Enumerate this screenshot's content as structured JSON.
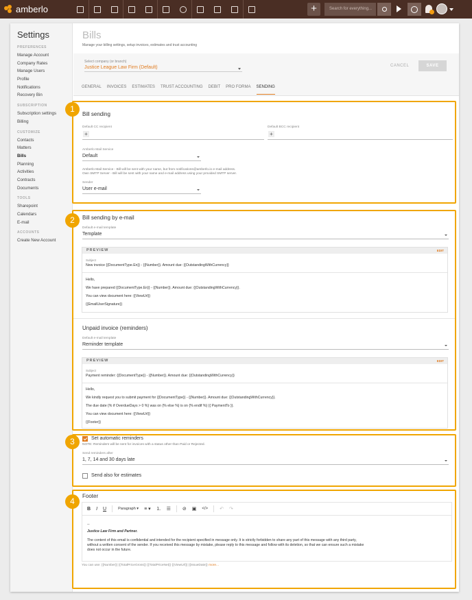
{
  "topbar": {
    "brand": "amberlo",
    "search_placeholder": "Search for everything...",
    "plus": "+",
    "nav_icons": [
      "dashboard-icon",
      "contacts-icon",
      "matters-icon",
      "documents-icon",
      "billing-icon",
      "calendar-icon",
      "time-icon",
      "folder-icon",
      "templates-icon",
      "mail-icon",
      "reports-icon"
    ]
  },
  "sidebar": {
    "title": "Settings",
    "sections": [
      {
        "header": "PREFERENCES",
        "items": [
          "Manage Account",
          "Company Rates",
          "Manage Users",
          "Profile",
          "Notifications",
          "Recovery Bin"
        ]
      },
      {
        "header": "SUBSCRIPTION",
        "items": [
          "Subscription settings",
          "Billing"
        ]
      },
      {
        "header": "CUSTOMIZE",
        "items": [
          "Contacts",
          "Matters",
          "Bills",
          "Planning",
          "Activities",
          "Contracts",
          "Documents"
        ]
      },
      {
        "header": "TOOLS",
        "items": [
          "Sharepoint",
          "Calendars",
          "E-mail"
        ]
      },
      {
        "header": "ACCOUNTS",
        "items": [
          "Create New Account"
        ]
      }
    ],
    "active": "Bills"
  },
  "page": {
    "title": "Bills",
    "subtitle": "Manage your billing settings, setup invoices, estimates and trust accounting",
    "company_label": "Select company (or branch)",
    "company_value": "Justice League Law Firm (Default)",
    "cancel": "CANCEL",
    "save": "SAVE",
    "tabs": [
      "GENERAL",
      "INVOICES",
      "ESTIMATES",
      "TRUST ACCOUNTING",
      "DEBIT",
      "PRO FORMA",
      "SENDING"
    ],
    "active_tab": "SENDING"
  },
  "sections": {
    "s1": {
      "badge": "1",
      "title": "Bill sending",
      "cc_label": "Default CC recipient",
      "bcc_label": "Default BCC recipient",
      "add": "+",
      "service_label": "Amberlo Mail Service",
      "service_value": "Default",
      "note1": "Amberlo Mail Service - Bill will be sent with your name, but from notifications@amberlo.io e-mail address.",
      "note2": "Own SMTP Server - Bill will be sent with your name and e-mail address using your provided SMTP server.",
      "sender_label": "Sender",
      "sender_value": "User e-mail"
    },
    "s2": {
      "badge": "2",
      "title": "Bill sending by e-mail",
      "tpl_label": "Default e-mail template",
      "tpl_value": "Template",
      "preview": "PREVIEW",
      "edit": "EDIT",
      "subject_label": "Subject",
      "subject": "New invoice {{DocumentType.En}} - {{Number}}. Amount due: {{OutstandingWithCurrency}}",
      "body": [
        "Hello,",
        "We have prepared {{DocumentType.En}} - {{Number}}. Amount due: {{OutstandingWithCurrency}}.",
        "You can view document here: {{ViewUrl}}",
        "{{EmailUserSignature}}"
      ],
      "unpaid_title": "Unpaid invoice (reminders)",
      "tpl2_label": "Default e-mail template",
      "tpl2_value": "Reminder template",
      "subject2": "Payment reminder: {{DocumentType}} - {{Number}}. Amount due: {{OutstandingWithCurrency}}",
      "body2": [
        "Hello,",
        "We kindly request you to submit payment for {{DocumentType}} - {{Number}}. Amount due: {{OutstandingWithCurrency}}.",
        "The due date {% if OverdueDays > 0 %} was on {% else %} is on {% endif %} {{ PaymentTo }}.",
        "You can view document here: {{ViewUrl}}",
        "{{Footer}}"
      ]
    },
    "s3": {
      "badge": "3",
      "auto_label": "Set automatic reminders",
      "auto_checked": true,
      "note": "NOTE: Reminders will be sent for invoices with a status other than Paid or Rejected.",
      "after_label": "Send reminders after",
      "after_value": "1, 7, 14 and 30 days late",
      "estimates_label": "Send also for estimates",
      "estimates_checked": false
    },
    "s4": {
      "badge": "4",
      "title": "Footer",
      "toolbar": {
        "bold": "B",
        "italic": "I",
        "underline": "U",
        "paragraph": "Paragraph ▾",
        "align": "≡ ▾",
        "ol": "⒈",
        "ul": "☰",
        "link": "⊘",
        "image": "▣",
        "code": "</>",
        "undo": "↶",
        "redo": "↷"
      },
      "lines": [
        "--",
        "Justice Law Firm and Partner.",
        "The content of this email is confidential and intended for the recipient specified in message only. It is strictly forbidden to share any part of this message with any third party,",
        "without a written consent of the sender. If you received this message by mistake, please reply to this message and follow with its deletion, so that we can ensure such a mistake",
        "does not occur in the future."
      ],
      "vars": "You can use: {{Number}} {{TotalPriceGross}} {{TotalPriceNet}} {{ViewUrl}} {{IssueDate}}",
      "more": "more..."
    }
  }
}
